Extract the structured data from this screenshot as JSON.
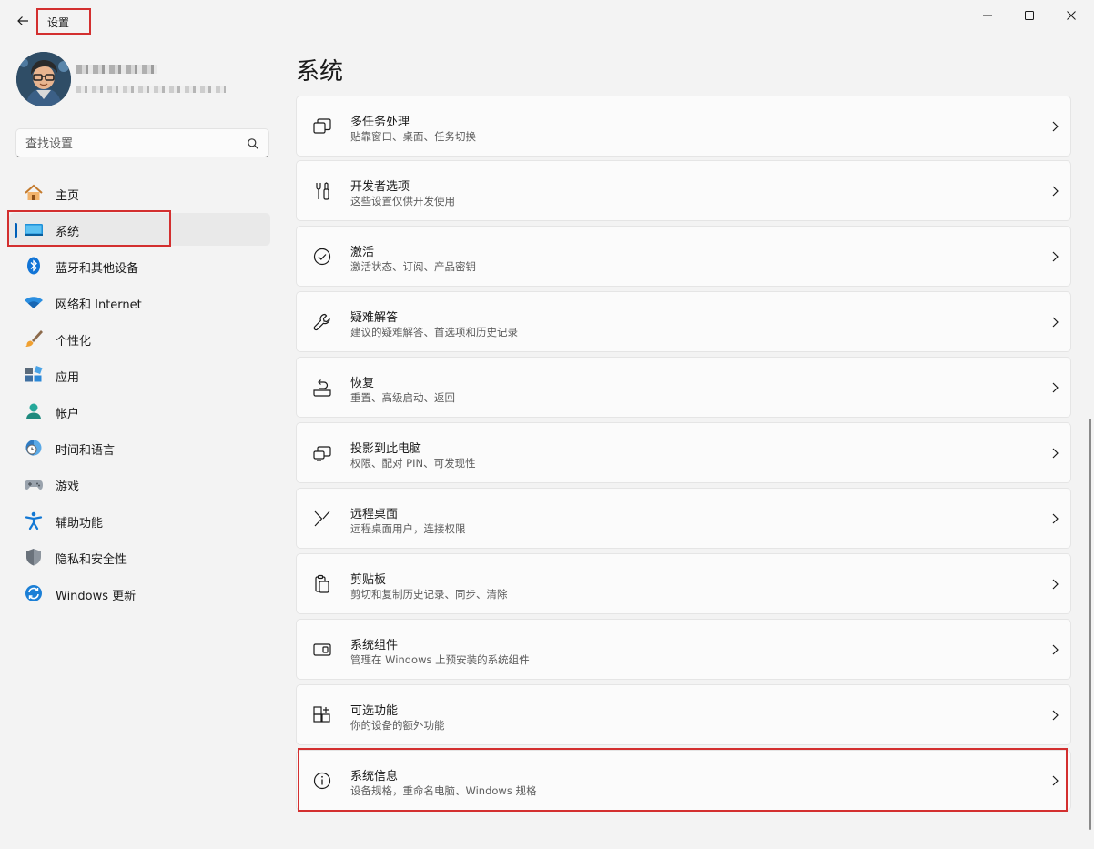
{
  "window": {
    "title": "设置",
    "back_icon": "back-arrow-icon",
    "controls": [
      "minimize-icon",
      "maximize-icon",
      "close-icon"
    ]
  },
  "profile": {
    "name_blurred": true,
    "email_blurred": true
  },
  "search": {
    "placeholder": "查找设置",
    "icon": "search-icon"
  },
  "sidebar": {
    "items": [
      {
        "label": "主页",
        "icon": "home-icon",
        "selected": false
      },
      {
        "label": "系统",
        "icon": "system-icon",
        "selected": true
      },
      {
        "label": "蓝牙和其他设备",
        "icon": "bluetooth-icon",
        "selected": false
      },
      {
        "label": "网络和 Internet",
        "icon": "wifi-icon",
        "selected": false
      },
      {
        "label": "个性化",
        "icon": "paintbrush-icon",
        "selected": false
      },
      {
        "label": "应用",
        "icon": "apps-icon",
        "selected": false
      },
      {
        "label": "帐户",
        "icon": "account-icon",
        "selected": false
      },
      {
        "label": "时间和语言",
        "icon": "clock-globe-icon",
        "selected": false
      },
      {
        "label": "游戏",
        "icon": "gamepad-icon",
        "selected": false
      },
      {
        "label": "辅助功能",
        "icon": "accessibility-icon",
        "selected": false
      },
      {
        "label": "隐私和安全性",
        "icon": "shield-icon",
        "selected": false
      },
      {
        "label": "Windows 更新",
        "icon": "windows-update-icon",
        "selected": false
      }
    ]
  },
  "main": {
    "title": "系统",
    "cards": [
      {
        "title": "多任务处理",
        "subtitle": "贴靠窗口、桌面、任务切换",
        "icon": "multitasking-icon"
      },
      {
        "title": "开发者选项",
        "subtitle": "这些设置仅供开发使用",
        "icon": "developer-tools-icon"
      },
      {
        "title": "激活",
        "subtitle": "激活状态、订阅、产品密钥",
        "icon": "activation-check-icon"
      },
      {
        "title": "疑难解答",
        "subtitle": "建议的疑难解答、首选项和历史记录",
        "icon": "wrench-icon"
      },
      {
        "title": "恢复",
        "subtitle": "重置、高级启动、返回",
        "icon": "recovery-icon"
      },
      {
        "title": "投影到此电脑",
        "subtitle": "权限、配对 PIN、可发现性",
        "icon": "project-to-pc-icon"
      },
      {
        "title": "远程桌面",
        "subtitle": "远程桌面用户，连接权限",
        "icon": "remote-desktop-icon"
      },
      {
        "title": "剪贴板",
        "subtitle": "剪切和复制历史记录、同步、清除",
        "icon": "clipboard-icon"
      },
      {
        "title": "系统组件",
        "subtitle": "管理在 Windows 上预安装的系统组件",
        "icon": "system-components-icon"
      },
      {
        "title": "可选功能",
        "subtitle": "你的设备的额外功能",
        "icon": "optional-features-icon"
      },
      {
        "title": "系统信息",
        "subtitle": "设备规格，重命名电脑、Windows 规格",
        "icon": "info-icon"
      }
    ]
  },
  "highlight_color": "#d32f2f",
  "accent_color": "#005fb8"
}
